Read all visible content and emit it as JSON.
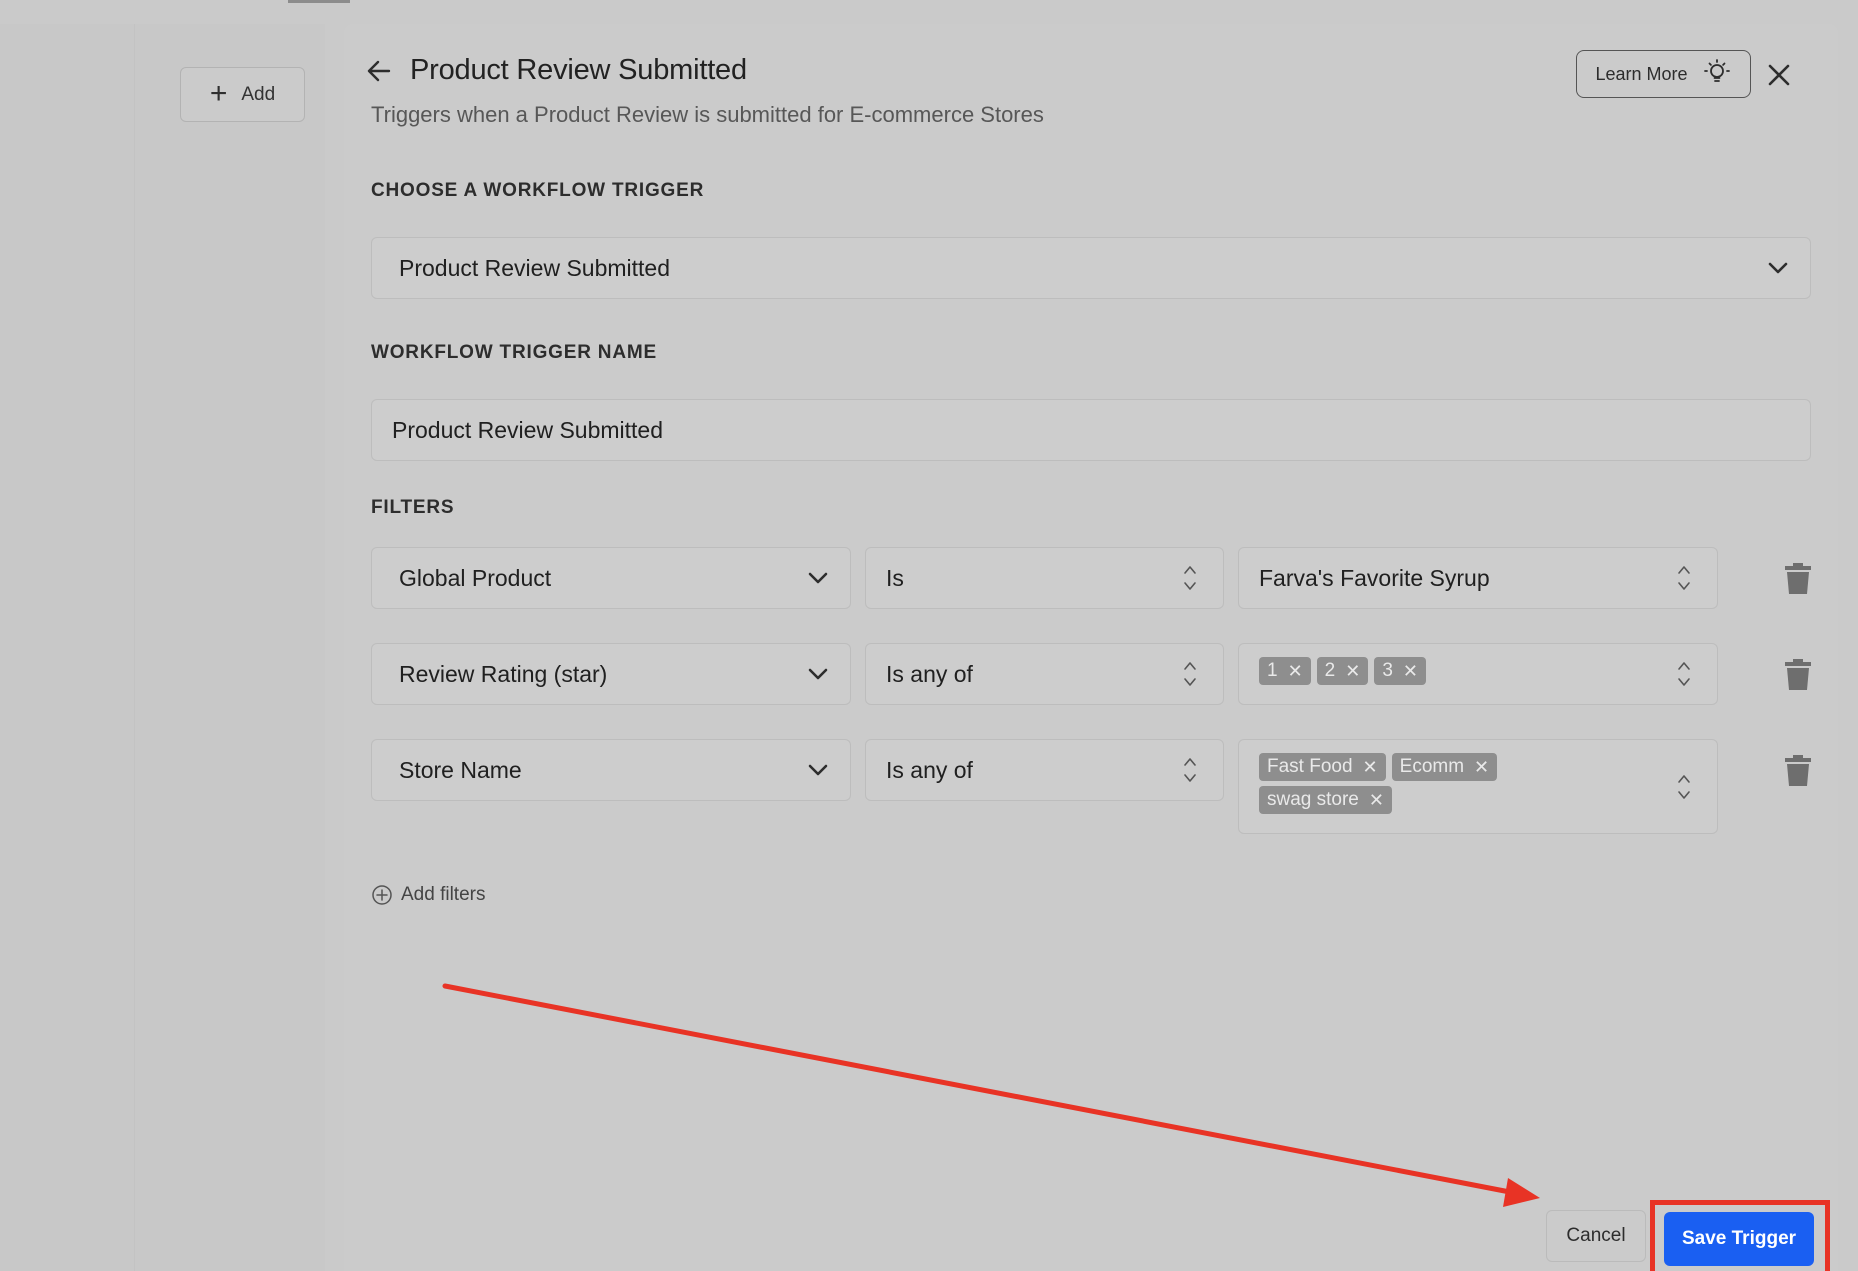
{
  "sidebar": {
    "add_label": "Add"
  },
  "header": {
    "title": "Product Review Submitted",
    "subtitle": "Triggers when a Product Review is submitted for E-commerce Stores",
    "learn_more": "Learn More"
  },
  "trigger": {
    "section_label": "CHOOSE A WORKFLOW TRIGGER",
    "selected": "Product Review Submitted"
  },
  "trigger_name": {
    "section_label": "WORKFLOW TRIGGER NAME",
    "value": "Product Review Submitted"
  },
  "filters": {
    "section_label": "FILTERS",
    "rows": [
      {
        "field": "Global Product",
        "operator": "Is",
        "value": "Farva's Favorite Syrup",
        "tags": []
      },
      {
        "field": "Review Rating (star)",
        "operator": "Is any of",
        "value": "",
        "tags": [
          "1",
          "2",
          "3"
        ]
      },
      {
        "field": "Store Name",
        "operator": "Is any of",
        "value": "",
        "tags": [
          "Fast Food",
          "Ecomm",
          "swag store"
        ]
      }
    ],
    "add_label": "Add filters"
  },
  "footer": {
    "cancel_label": "Cancel",
    "save_label": "Save Trigger"
  },
  "colors": {
    "primary": "#1a5ff2",
    "annotation": "#e83325",
    "tag_bg": "#8e8e8e"
  }
}
